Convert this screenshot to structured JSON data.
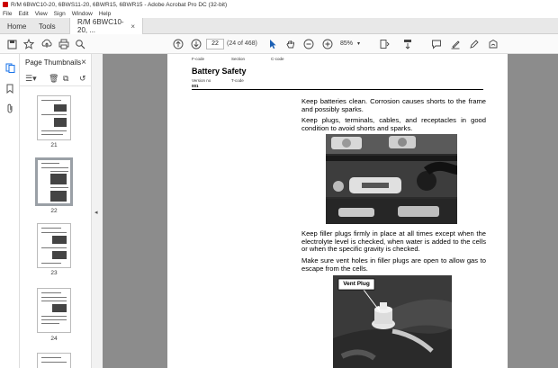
{
  "window": {
    "title": "R/M 6BWC10-20, 6BWS11-20, 6BWR15, 6BWR15 - Adobe Acrobat Pro DC (32-bit)"
  },
  "menu": [
    "File",
    "Edit",
    "View",
    "Sign",
    "Window",
    "Help"
  ],
  "tabs": {
    "home": "Home",
    "tools": "Tools",
    "document": "R/M 6BWC10-20, ...",
    "close": "×"
  },
  "toolbar": {
    "page_input": "22",
    "page_count": "(24 of 468)",
    "zoom": "85%"
  },
  "thumbnails": {
    "title": "Page Thumbnails",
    "close": "×",
    "pages": [
      "21",
      "22",
      "23",
      "24"
    ]
  },
  "page": {
    "header_fcode": "F-code",
    "header_section": "Section",
    "header_ccode": "C-code",
    "title": "Battery Safety",
    "version_label": "Version no",
    "tcode_label": "T-code",
    "version_number": "001",
    "para1": "Keep batteries clean. Corrosion causes shorts to the frame and possibly sparks.",
    "para2": "Keep plugs, terminals, cables, and receptacles in good condition to avoid shorts and sparks.",
    "para3": "Keep filler plugs firmly in place at all times except when the electrolyte level is checked, when water is added to the cells or when the specific gravity is checked.",
    "para4": "Make sure vent holes in filler plugs are open to allow gas to escape from the cells.",
    "callout": "Vent Plug"
  }
}
